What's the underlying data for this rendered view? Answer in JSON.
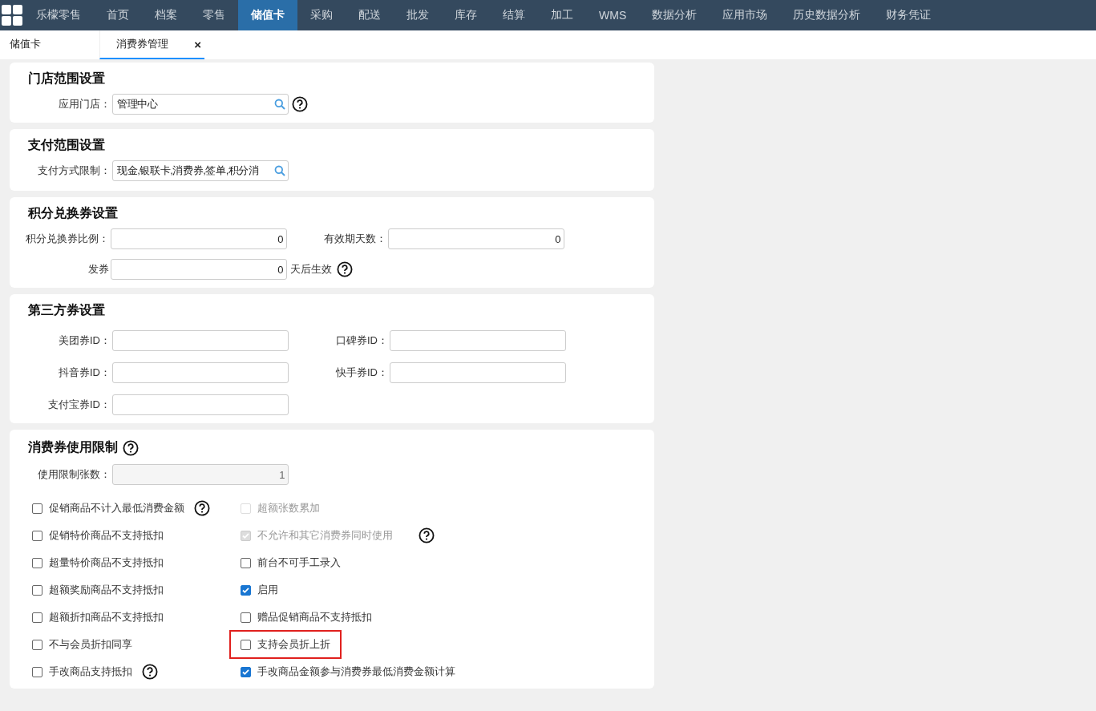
{
  "nav": {
    "items": [
      {
        "label": "乐檬零售",
        "selected": false
      },
      {
        "label": "首页",
        "selected": false
      },
      {
        "label": "档案",
        "selected": false
      },
      {
        "label": "零售",
        "selected": false
      },
      {
        "label": "储值卡",
        "selected": true
      },
      {
        "label": "采购",
        "selected": false
      },
      {
        "label": "配送",
        "selected": false
      },
      {
        "label": "批发",
        "selected": false
      },
      {
        "label": "库存",
        "selected": false
      },
      {
        "label": "结算",
        "selected": false
      },
      {
        "label": "加工",
        "selected": false
      },
      {
        "label": "WMS",
        "selected": false
      },
      {
        "label": "数据分析",
        "selected": false
      },
      {
        "label": "应用市场",
        "selected": false
      },
      {
        "label": "历史数据分析",
        "selected": false
      },
      {
        "label": "财务凭证",
        "selected": false
      }
    ]
  },
  "tabs": [
    {
      "label": "储值卡",
      "selected": false
    },
    {
      "label": "消费券管理",
      "selected": true,
      "close": "×"
    }
  ],
  "store_scope": {
    "title": "门店范围设置",
    "field": {
      "label": "应用门店：",
      "value": "管理中心",
      "help": true
    }
  },
  "payment_scope": {
    "title": "支付范围设置",
    "field": {
      "label": "支付方式限制：",
      "value": "现金,银联卡,消费券,签单,积分消",
      "help": false
    }
  },
  "points": {
    "title": "积分兑换券设置",
    "ratio": {
      "label": "积分兑换券比例：",
      "value": "0"
    },
    "valid_days": {
      "label": "有效期天数：",
      "value": "0"
    },
    "issue": {
      "label": "发券",
      "value": "0",
      "suffix": "天后生效"
    }
  },
  "third_party": {
    "title": "第三方券设置",
    "fields": [
      {
        "label": "美团券ID："
      },
      {
        "label": "口碑券ID："
      },
      {
        "label": "抖音券ID："
      },
      {
        "label": "快手券ID："
      },
      {
        "label": "支付宝券ID："
      }
    ]
  },
  "usage": {
    "title": "消费券使用限制",
    "limit": {
      "label": "使用限制张数：",
      "value": "1",
      "disabled": true
    },
    "options_left": [
      {
        "label": "促销商品不计入最低消费金额",
        "checked": false,
        "disabled": false,
        "help": true,
        "highlighted": false
      },
      {
        "label": "促销特价商品不支持抵扣",
        "checked": false,
        "disabled": false,
        "help": false,
        "highlighted": false
      },
      {
        "label": "超量特价商品不支持抵扣",
        "checked": false,
        "disabled": false,
        "help": false,
        "highlighted": false
      },
      {
        "label": "超额奖励商品不支持抵扣",
        "checked": false,
        "disabled": false,
        "help": false,
        "highlighted": false
      },
      {
        "label": "超额折扣商品不支持抵扣",
        "checked": false,
        "disabled": false,
        "help": false,
        "highlighted": false
      },
      {
        "label": "不与会员折扣同享",
        "checked": false,
        "disabled": false,
        "help": false,
        "highlighted": false
      },
      {
        "label": "手改商品支持抵扣",
        "checked": false,
        "disabled": false,
        "help": true,
        "highlighted": false
      }
    ],
    "options_right": [
      {
        "label": "超额张数累加",
        "checked": false,
        "disabled": true,
        "help": false,
        "highlighted": false
      },
      {
        "label": "不允许和其它消费券同时使用",
        "checked": true,
        "disabled": true,
        "help": true,
        "highlighted": false
      },
      {
        "label": "前台不可手工录入",
        "checked": false,
        "disabled": false,
        "help": false,
        "highlighted": false
      },
      {
        "label": "启用",
        "checked": true,
        "disabled": false,
        "help": false,
        "highlighted": false
      },
      {
        "label": "赠品促销商品不支持抵扣",
        "checked": false,
        "disabled": false,
        "help": false,
        "highlighted": false
      },
      {
        "label": "支持会员折上折",
        "checked": false,
        "disabled": false,
        "help": false,
        "highlighted": true
      },
      {
        "label": "手改商品金额参与消费券最低消费金额计算",
        "checked": true,
        "disabled": false,
        "help": false,
        "highlighted": false
      }
    ]
  }
}
